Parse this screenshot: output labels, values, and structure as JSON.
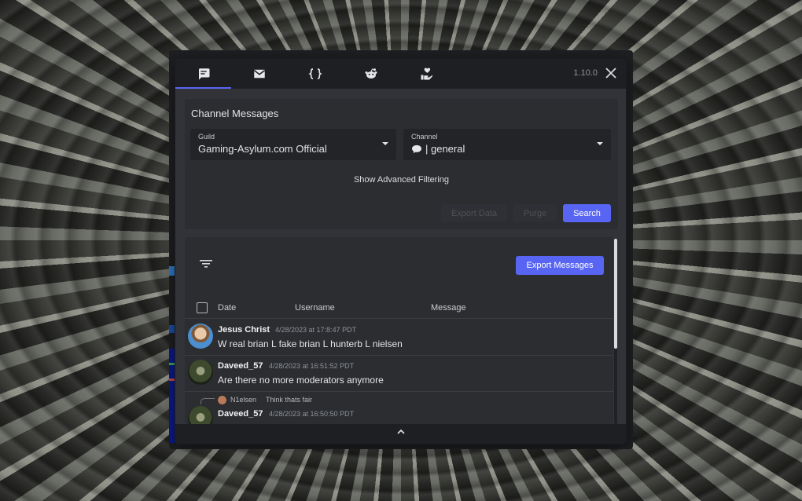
{
  "app": {
    "version": "1.10.0",
    "tabs": [
      {
        "icon": "chat-bubble-icon",
        "active": true
      },
      {
        "icon": "mail-icon",
        "active": false
      },
      {
        "icon": "braces-icon",
        "active": false
      },
      {
        "icon": "reddit-icon",
        "active": false
      },
      {
        "icon": "hand-heart-icon",
        "active": false
      }
    ]
  },
  "filter": {
    "title": "Channel Messages",
    "guild_label": "Guild",
    "guild_value": "Gaming-Asylum.com Official",
    "channel_label": "Channel",
    "channel_value": "| general",
    "advanced_label": "Show Advanced Filtering",
    "export_data_label": "Export Data",
    "purge_label": "Purge",
    "search_label": "Search"
  },
  "results": {
    "export_label": "Export Messages",
    "columns": [
      "Date",
      "Username",
      "Message"
    ],
    "messages": [
      {
        "username": "Jesus Christ",
        "time": "4/28/2023 at 17:8:47 PDT",
        "text": "W real brian L fake brian L hunterb L nielsen"
      },
      {
        "username": "Daveed_57",
        "time": "4/28/2023 at 16:51:52 PDT",
        "text": "Are there no more moderators anymore"
      },
      {
        "username": "Daveed_57",
        "time": "4/28/2023 at 16:50:50 PDT",
        "text": "",
        "reply_to_user": "N1elsen",
        "reply_to_text": "Think thats fair"
      }
    ]
  },
  "colors": {
    "accent": "#5865f2",
    "panel": "#2b2d31",
    "window": "#313338",
    "tabbar": "#1e1f22"
  }
}
